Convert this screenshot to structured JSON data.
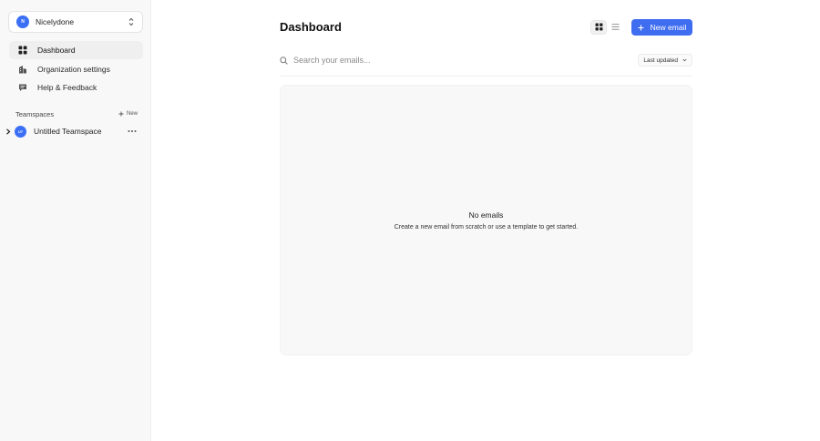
{
  "sidebar": {
    "workspace": {
      "avatar_initial": "N",
      "name": "Nicelydone"
    },
    "nav_items": [
      {
        "label": "Dashboard",
        "icon": "grid-icon",
        "active": true
      },
      {
        "label": "Organization settings",
        "icon": "buildings-icon",
        "active": false
      },
      {
        "label": "Help & Feedback",
        "icon": "chat-bubble-icon",
        "active": false
      }
    ],
    "teamspaces": {
      "title": "Teamspaces",
      "new_label": "New",
      "items": [
        {
          "avatar_initials": "UT",
          "name": "Untitled Teamspace"
        }
      ]
    }
  },
  "main": {
    "title": "Dashboard",
    "new_email_label": "New email",
    "search": {
      "placeholder": "Search your emails..."
    },
    "sort": {
      "selected": "Last updated"
    },
    "empty_state": {
      "title": "No emails",
      "description": "Create a new email from scratch or use a template to get started."
    }
  },
  "colors": {
    "accent": "#3f6df0",
    "avatar": "#3b6ff5",
    "sidebar_bg": "#f8f8f8"
  }
}
